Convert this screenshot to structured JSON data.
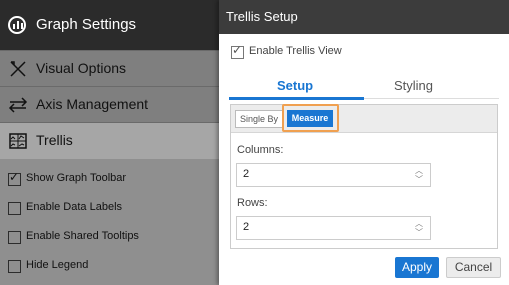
{
  "left_panel": {
    "header_title": "Graph Settings",
    "menu": [
      {
        "label": "Visual Options"
      },
      {
        "label": "Axis Management"
      },
      {
        "label": "Trellis"
      }
    ],
    "options": [
      {
        "label": "Show Graph Toolbar",
        "checked": true
      },
      {
        "label": "Enable Data Labels",
        "checked": false
      },
      {
        "label": "Enable Shared Tooltips",
        "checked": false
      },
      {
        "label": "Hide Legend",
        "checked": false
      }
    ]
  },
  "dialog": {
    "title": "Trellis Setup",
    "enable_label": "Enable Trellis View",
    "enable_checked": true,
    "tabs": [
      {
        "label": "Setup",
        "active": true
      },
      {
        "label": "Styling",
        "active": false
      }
    ],
    "segments": {
      "single": "Single By",
      "measure": "Measure",
      "selected": "Measure"
    },
    "columns_label": "Columns:",
    "columns_value": "2",
    "rows_label": "Rows:",
    "rows_value": "2",
    "apply_label": "Apply",
    "cancel_label": "Cancel"
  },
  "colors": {
    "accent": "#1976d2",
    "highlight": "#f0a050"
  }
}
